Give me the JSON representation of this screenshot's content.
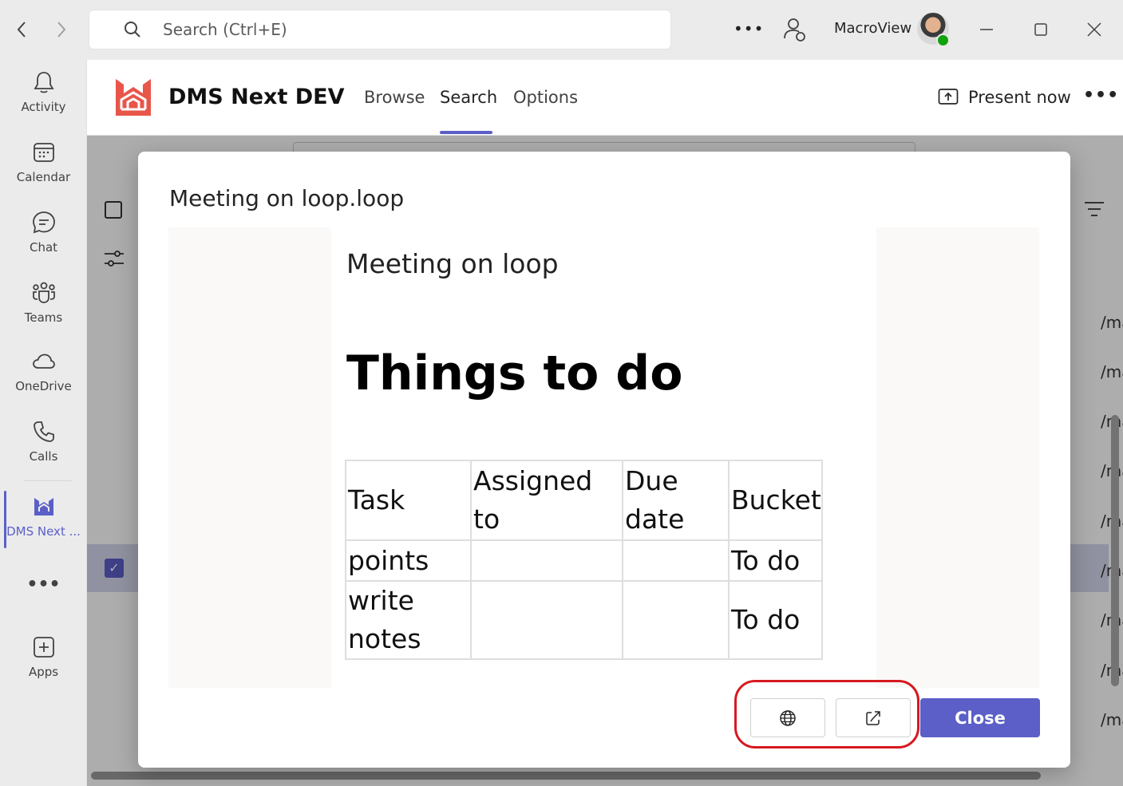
{
  "titlebar": {
    "search_placeholder": "Search (Ctrl+E)",
    "more": "•••",
    "user_name": "MacroView"
  },
  "rail": {
    "items": [
      {
        "label": "Activity",
        "icon": "bell-icon"
      },
      {
        "label": "Calendar",
        "icon": "calendar-icon"
      },
      {
        "label": "Chat",
        "icon": "chat-icon"
      },
      {
        "label": "Teams",
        "icon": "teams-icon"
      },
      {
        "label": "OneDrive",
        "icon": "cloud-icon"
      },
      {
        "label": "Calls",
        "icon": "phone-icon"
      },
      {
        "label": "DMS Next ...",
        "icon": "dms-logo-icon"
      },
      {
        "label": "•••",
        "icon": "more-icon"
      },
      {
        "label": "Apps",
        "icon": "add-app-icon"
      }
    ]
  },
  "app": {
    "title": "DMS Next DEV",
    "tabs": [
      {
        "label": "Browse"
      },
      {
        "label": "Search"
      },
      {
        "label": "Options"
      }
    ],
    "active_tab": "Search",
    "present_label": "Present now",
    "more": "•••"
  },
  "background": {
    "path_fragment": "/mac"
  },
  "dialog": {
    "title": "Meeting on loop.loop",
    "document": {
      "subtitle": "Meeting on loop",
      "heading": "Things to do",
      "table": {
        "headers": [
          "Task",
          "Assigned to",
          "Due date",
          "Bucket"
        ],
        "rows": [
          [
            "points",
            "",
            "",
            "To do"
          ],
          [
            "write notes",
            "",
            "",
            "To do"
          ]
        ]
      }
    },
    "close_label": "Close"
  },
  "colors": {
    "accent": "#5b5fc7",
    "brand_logo": "#e8564a",
    "highlight": "#d71920"
  }
}
